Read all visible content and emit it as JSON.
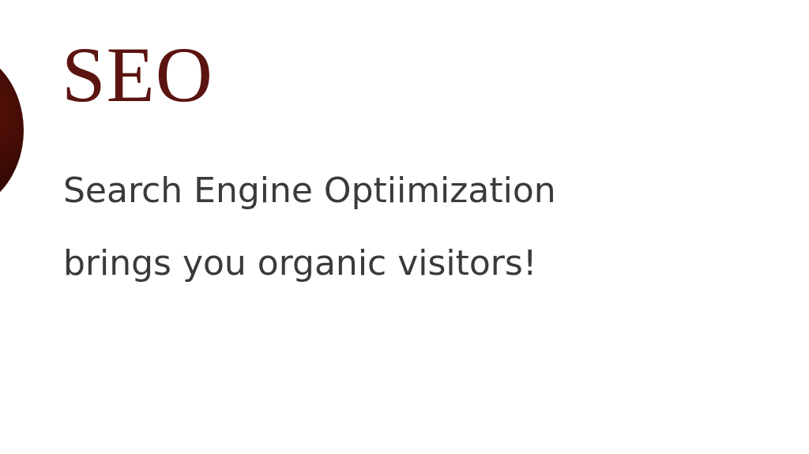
{
  "service": {
    "icon": "circle-icon",
    "title": "SEO",
    "line1": "Search Engine Optiimization",
    "line2": "brings you organic visitors!"
  },
  "colors": {
    "title": "#5c1410",
    "text": "#3a3a3a",
    "icon": "#3a0a04",
    "background": "#ffffff"
  }
}
